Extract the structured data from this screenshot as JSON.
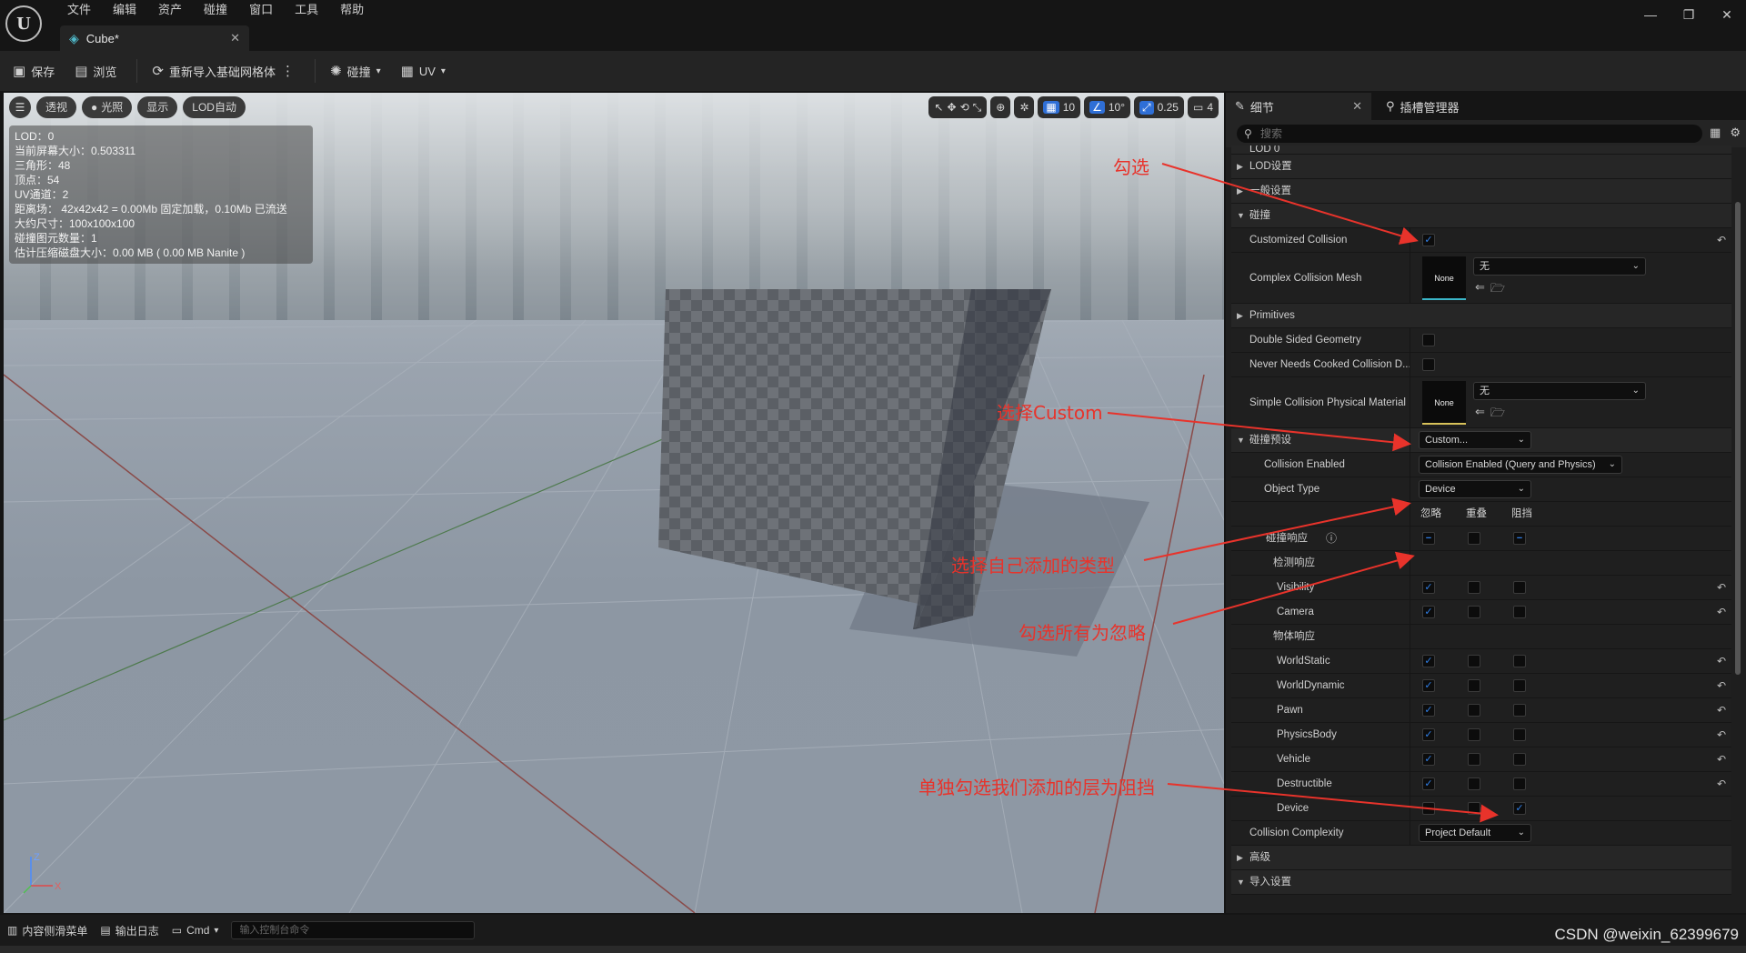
{
  "app": {
    "logo_glyph": "U",
    "menu": [
      "文件",
      "编辑",
      "资产",
      "碰撞",
      "窗口",
      "工具",
      "帮助"
    ],
    "doc_tab": "Cube*",
    "window_controls": [
      "—",
      "❐",
      "✕"
    ]
  },
  "toolbar": {
    "save": "保存",
    "browse": "浏览",
    "reimport": "重新导入基础网格体",
    "collision": "碰撞",
    "uv": "UV"
  },
  "viewport": {
    "perspective": "透视",
    "lit": "光照",
    "show": "显示",
    "lod_auto": "LOD自动",
    "grid_size": "10",
    "rot_snap": "10°",
    "scale_snap": "0.25",
    "camera_speed": "4",
    "stats": [
      "LOD：0",
      "当前屏幕大小：0.503311",
      "三角形：48",
      "顶点：54",
      "UV通道：2",
      "距离场： 42x42x42 = 0.00Mb 固定加载，0.10Mb 已流送",
      "大约尺寸：100x100x100",
      "碰撞图元数量：1",
      "估计压缩磁盘大小：0.00 MB ( 0.00 MB Nanite )"
    ],
    "axis_z": "Z",
    "axis_x": "X"
  },
  "details": {
    "tab_details": "细节",
    "tab_socket": "插槽管理器",
    "search_placeholder": "搜索",
    "cut_row": "LOD 0",
    "lod_settings": "LOD设置",
    "general_settings": "一般设置",
    "collision": "碰撞",
    "customized_collision": "Customized Collision",
    "complex_collision_mesh": "Complex Collision Mesh",
    "none_thumb": "None",
    "none_select": "无",
    "primitives": "Primitives",
    "double_sided": "Double Sided Geometry",
    "never_cooked": "Never Needs Cooked Collision D...",
    "simple_phys_mat": "Simple Collision Physical Material",
    "collision_presets": "碰撞预设",
    "preset_value": "Custom...",
    "collision_enabled": "Collision Enabled",
    "collision_enabled_value": "Collision Enabled (Query and Physics)",
    "object_type": "Object Type",
    "object_type_value": "Device",
    "col_ignore": "忽略",
    "col_overlap": "重叠",
    "col_block": "阻挡",
    "collision_responses": "碰撞响应",
    "trace_responses": "检测响应",
    "object_responses": "物体响应",
    "trace_channels": [
      "Visibility",
      "Camera"
    ],
    "object_channels": [
      "WorldStatic",
      "WorldDynamic",
      "Pawn",
      "PhysicsBody",
      "Vehicle",
      "Destructible",
      "Device"
    ],
    "collision_complexity": "Collision Complexity",
    "complexity_value": "Project Default",
    "advanced": "高级",
    "import_settings": "导入设置"
  },
  "annotations": {
    "check": "勾选",
    "select_custom": "选择Custom",
    "select_own_type": "选择自己添加的类型",
    "check_all_ignore": "勾选所有为忽略",
    "block_only_ours": "单独勾选我们添加的层为阻挡"
  },
  "bottom": {
    "content_drawer": "内容侧滑菜单",
    "output_log": "输出日志",
    "cmd": "Cmd",
    "console_placeholder": "输入控制台命令",
    "watermark": "CSDN @weixin_62399679"
  },
  "colors": {
    "accent_blue": "#2f7fe8",
    "annotation_red": "#e8332b",
    "mesh_cyan": "#4fb8c9"
  }
}
